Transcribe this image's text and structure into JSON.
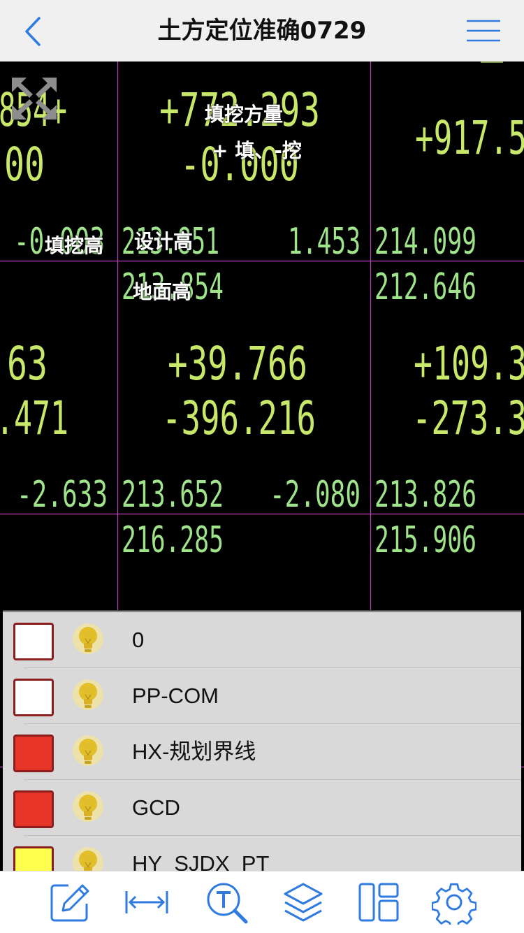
{
  "nav": {
    "title": "土方定位准确0729",
    "back_icon": "chevron-left-icon",
    "menu_icon": "hamburger-menu-icon"
  },
  "canvas": {
    "colors": {
      "background": "#000000",
      "grid_line": "#c040c0",
      "cad_text": "#c8e86a",
      "cad_text_green": "#9fe38a",
      "label": "#ffffff"
    },
    "cad_numbers": {
      "c1_fill": "+772.293",
      "c1_cut": "-0.000",
      "c0_top_a": "854+",
      "c0_top_b": "00",
      "c2_fill": "+917.5",
      "c0_height": "-0.003",
      "c1_design": "213.851",
      "c1_fillcut": "1.453",
      "c2_design": "214.099",
      "c1_ground": "213.854",
      "c2_ground": "212.646",
      "c0_mid_a": "63",
      "c0_mid_b": ".471",
      "c1_mid_fill": "+39.766",
      "c1_mid_cut": "-396.216",
      "c2_mid_fill": "+109.3",
      "c2_mid_cut": "-273.3",
      "c0_bot": "-2.633",
      "c1_bot_design": "213.652",
      "c1_bot_fillcut": "-2.080",
      "c2_bot_design": "213.826",
      "c1_bot_ground": "216.285",
      "c2_bot_ground": "215.906"
    },
    "labels": {
      "fill_cut_volume": "填挖方量",
      "fill_cut_sign": "+ 填、-挖",
      "fill_cut_height": "填挖高",
      "design_height": "设计高",
      "ground_height": "地面高"
    },
    "expand_icon": "expand-arrows-icon"
  },
  "layers": {
    "items": [
      {
        "name": "0",
        "color": "#ffffff",
        "bulb": "lightbulb-on-icon"
      },
      {
        "name": "PP-COM",
        "color": "#ffffff",
        "bulb": "lightbulb-on-icon"
      },
      {
        "name": "HX-规划界线",
        "color": "#e8352a",
        "bulb": "lightbulb-on-icon"
      },
      {
        "name": "GCD",
        "color": "#e8352a",
        "bulb": "lightbulb-on-icon"
      },
      {
        "name": "HY_SJDX_PT",
        "color": "#ffff4d",
        "bulb": "lightbulb-on-icon"
      }
    ]
  },
  "toolbar": {
    "accent": "#2f7be0",
    "items": [
      "edit-icon",
      "measure-icon",
      "text-search-icon",
      "layers-icon",
      "layout-icon",
      "settings-icon"
    ]
  }
}
